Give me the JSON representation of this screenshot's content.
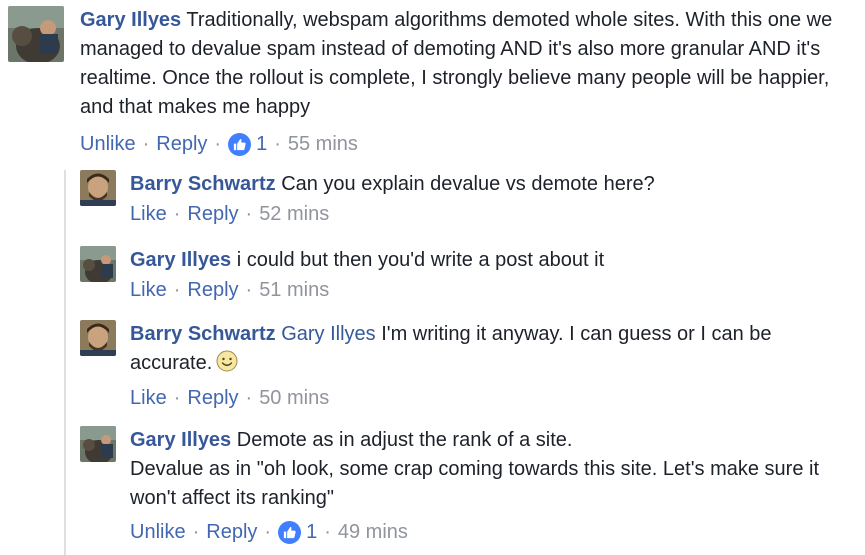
{
  "comments": [
    {
      "author": "Gary Illyes",
      "mention": "",
      "text": "Traditionally, webspam algorithms demoted whole sites. With this one we managed to devalue spam instead of demoting AND it's also more granular AND it's realtime. Once the rollout is complete, I strongly believe many people will be happier, and that makes me happy",
      "action1": "Unlike",
      "action2": "Reply",
      "likes": "1",
      "time": "55 mins"
    },
    {
      "author": "Barry Schwartz",
      "text": "Can you explain devalue vs demote here?",
      "action1": "Like",
      "action2": "Reply",
      "time": "52 mins"
    },
    {
      "author": "Gary Illyes",
      "text": "i could but then you'd write a post about it",
      "action1": "Like",
      "action2": "Reply",
      "time": "51 mins"
    },
    {
      "author": "Barry Schwartz",
      "mention": "Gary Illyes",
      "text": "I'm writing it anyway. I can guess or I can be accurate.",
      "action1": "Like",
      "action2": "Reply",
      "time": "50 mins"
    },
    {
      "author": "Gary Illyes",
      "text_line1": "Demote as in adjust the rank of a site.",
      "text_line2": "Devalue as in \"oh look, some crap coming towards this site. Let's make sure it won't affect its ranking\"",
      "action1": "Unlike",
      "action2": "Reply",
      "likes": "1",
      "time": "49 mins"
    }
  ],
  "separator": "·",
  "colors": {
    "author": "#365899",
    "action": "#4267b2",
    "meta": "#90949c",
    "like_badge": "#4080ff"
  },
  "icons": {
    "like_badge": "thumbs-up-icon",
    "emoji": "smiley-icon"
  }
}
